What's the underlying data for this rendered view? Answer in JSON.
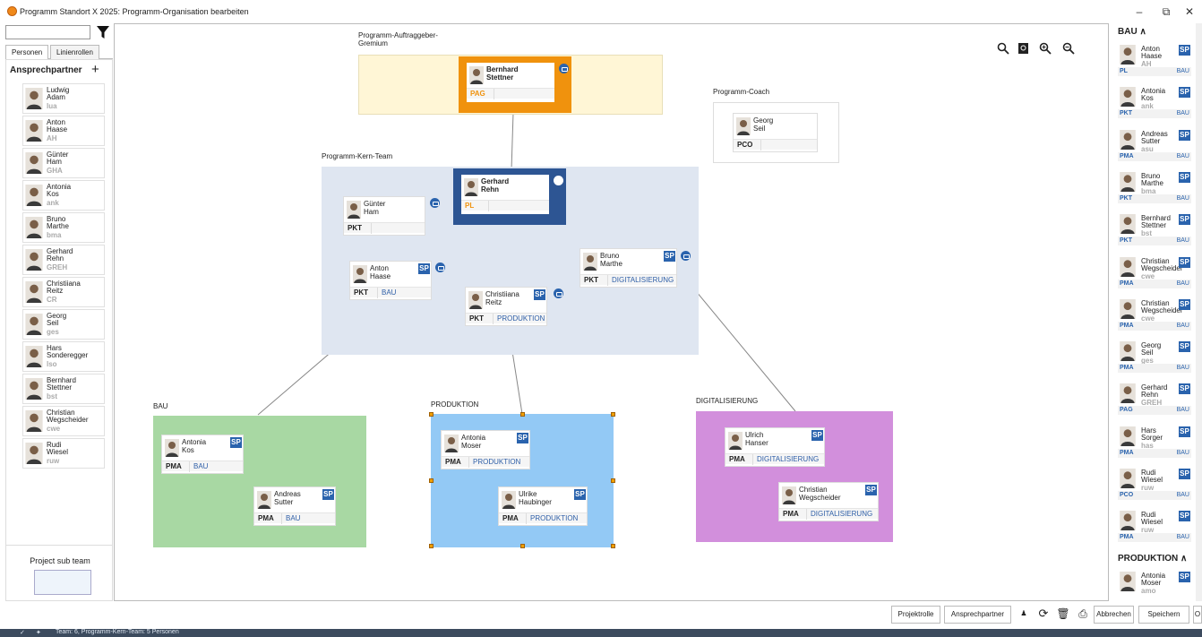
{
  "window": {
    "title": "Programm Standort X 2025: Programm-Organisation bearbeiten",
    "minimize": "–",
    "maximize": "⧉",
    "close": "✕"
  },
  "left": {
    "tabs": [
      "Personen",
      "Linienrollen"
    ],
    "header": "Ansprechpartner",
    "add": "+",
    "people": [
      {
        "n1": "Ludwig",
        "n2": "Adam",
        "ab": "lua"
      },
      {
        "n1": "Anton",
        "n2": "Haase",
        "ab": "AH"
      },
      {
        "n1": "Günter",
        "n2": "Ham",
        "ab": "GHA"
      },
      {
        "n1": "Antonia",
        "n2": "Kos",
        "ab": "ank"
      },
      {
        "n1": "Bruno",
        "n2": "Marthe",
        "ab": "bma"
      },
      {
        "n1": "Gerhard",
        "n2": "Rehn",
        "ab": "GREH"
      },
      {
        "n1": "Christiiana",
        "n2": "Reitz",
        "ab": "CR"
      },
      {
        "n1": "Georg",
        "n2": "Seil",
        "ab": "ges"
      },
      {
        "n1": "Hars",
        "n2": "Sonderegger",
        "ab": "lso"
      },
      {
        "n1": "Bernhard",
        "n2": "Stettner",
        "ab": "bst"
      },
      {
        "n1": "Christian",
        "n2": "Wegscheider",
        "ab": "cwe"
      },
      {
        "n1": "Rudi",
        "n2": "Wiesel",
        "ab": "ruw"
      }
    ],
    "subteam": "Project sub team"
  },
  "canvas": {
    "zoom_icons": [
      "search-icon",
      "fit-icon",
      "zoom-in-icon",
      "zoom-out-icon"
    ],
    "pag_label": "Programm-Auftraggeber-\nGremium",
    "coach_label": "Programm-Coach",
    "kern_label": "Programm-Kern-Team",
    "bau_label": "BAU",
    "prod_label": "PRODUKTION",
    "digi_label": "DIGITALISIERUNG",
    "sp": "SP",
    "cards": {
      "bernhard": {
        "n1": "Bernhard",
        "n2": "Stettner",
        "role": "PAG",
        "ou": ""
      },
      "georg": {
        "n1": "Georg",
        "n2": "Seil",
        "role": "PCO",
        "ou": ""
      },
      "gerhard": {
        "n1": "Gerhard",
        "n2": "Rehn",
        "role": "PL",
        "ou": ""
      },
      "guenter": {
        "n1": "Günter",
        "n2": "Ham",
        "role": "PKT",
        "ou": ""
      },
      "anton": {
        "n1": "Anton",
        "n2": "Haase",
        "role": "PKT",
        "ou": "BAU"
      },
      "christiiana": {
        "n1": "Christiiana",
        "n2": "Reitz",
        "role": "PKT",
        "ou": "PRODUKTION"
      },
      "bruno": {
        "n1": "Bruno",
        "n2": "Marthe",
        "role": "PKT",
        "ou": "DIGITALISIERUNG"
      },
      "antonia": {
        "n1": "Antonia",
        "n2": "Kos",
        "role": "PMA",
        "ou": "BAU"
      },
      "andreas": {
        "n1": "Andreas",
        "n2": "Sutter",
        "role": "PMA",
        "ou": "BAU"
      },
      "antonia_m": {
        "n1": "Antonia",
        "n2": "Moser",
        "role": "PMA",
        "ou": "PRODUKTION"
      },
      "ulrike": {
        "n1": "Ulrike",
        "n2": "Haubinger",
        "role": "PMA",
        "ou": "PRODUKTION"
      },
      "ulrich": {
        "n1": "Ulrich",
        "n2": "Hanser",
        "role": "PMA",
        "ou": "DIGITALISIERUNG"
      },
      "christian": {
        "n1": "Christian",
        "n2": "Wegscheider",
        "role": "PMA",
        "ou": "DIGITALISIERUNG"
      }
    }
  },
  "right": {
    "sec1": "BAU ∧",
    "sec2": "PRODUKTION ∧",
    "items": [
      {
        "n1": "Anton",
        "n2": "Haase",
        "ab": "AH",
        "r": "PL",
        "o": "BAU"
      },
      {
        "n1": "Antonia",
        "n2": "Kos",
        "ab": "ank",
        "r": "PKT",
        "o": "BAU"
      },
      {
        "n1": "Andreas",
        "n2": "Sutter",
        "ab": "asu",
        "r": "PMA",
        "o": "BAU"
      },
      {
        "n1": "Bruno",
        "n2": "Marthe",
        "ab": "bma",
        "r": "PKT",
        "o": "BAU"
      },
      {
        "n1": "Bernhard",
        "n2": "Stettner",
        "ab": "bst",
        "r": "PKT",
        "o": "BAU"
      },
      {
        "n1": "Christian",
        "n2": "Wegscheider",
        "ab": "cwe",
        "r": "PMA",
        "o": "BAU"
      },
      {
        "n1": "Christian",
        "n2": "Wegscheider",
        "ab": "cwe",
        "r": "PMA",
        "o": "BAU"
      },
      {
        "n1": "Georg",
        "n2": "Seil",
        "ab": "ges",
        "r": "PMA",
        "o": "BAU"
      },
      {
        "n1": "Gerhard",
        "n2": "Rehn",
        "ab": "GREH",
        "r": "PAG",
        "o": "BAU"
      },
      {
        "n1": "Hars",
        "n2": "Sorger",
        "ab": "has",
        "r": "PMA",
        "o": "BAU"
      },
      {
        "n1": "Rudi",
        "n2": "Wiesel",
        "ab": "ruw",
        "r": "PCO",
        "o": "BAU"
      },
      {
        "n1": "Rudi",
        "n2": "Wiesel",
        "ab": "ruw",
        "r": "PMA",
        "o": "BAU"
      }
    ],
    "prod_item": {
      "n1": "Antonia",
      "n2": "Moser",
      "ab": "amo"
    }
  },
  "buttons": {
    "projektrolle": "Projektrolle",
    "ansprechpartner": "Ansprechpartner",
    "abbrechen": "Abbrechen",
    "speichern": "Speichern",
    "ok": "O"
  },
  "status": "Team: 6, Programm-Kern-Team: 5 Personen",
  "colors": {
    "pag_bg": "#fff6d6",
    "pag_card": "#f0920d",
    "kern_bg": "#dfe6f1",
    "pl_card": "#2d5593",
    "bau_bg": "#a8d8a3",
    "prod_bg": "#93c9f5",
    "digi_bg": "#d28fdc",
    "accent": "#2a63ad"
  }
}
